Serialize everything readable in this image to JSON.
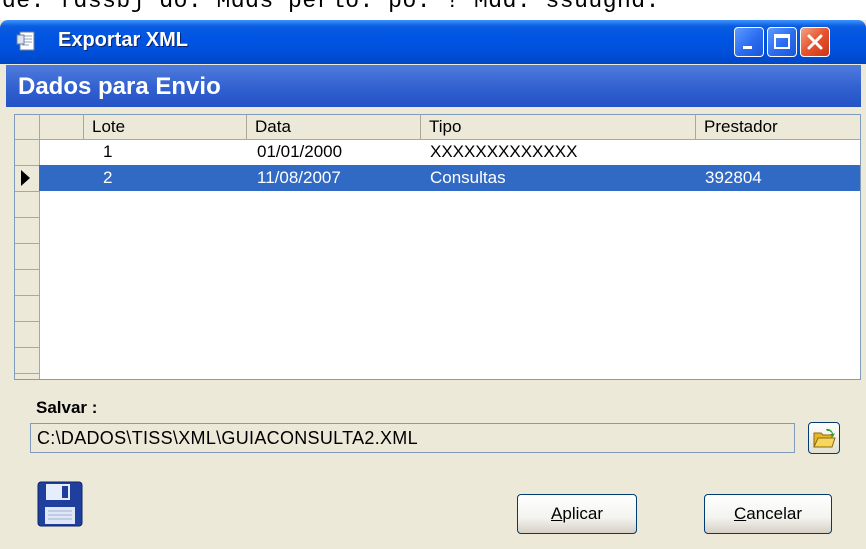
{
  "top_strip_text": "de: fdssbj do: Mdds perlo: po: ! Mdd: ssuugnd:",
  "window": {
    "title": "Exportar XML",
    "section_title": "Dados para Envio"
  },
  "grid": {
    "columns": [
      "Lote",
      "Data",
      "Tipo",
      "Prestador"
    ],
    "rows": [
      {
        "lote": "1",
        "data": "01/01/2000",
        "tipo": "XXXXXXXXXXXXX",
        "prestador": ""
      },
      {
        "lote": "2",
        "data": "11/08/2007",
        "tipo": "Consultas",
        "prestador": "392804"
      }
    ],
    "selected_row": 2
  },
  "save": {
    "label": "Salvar :",
    "path": "C:\\DADOS\\TISS\\XML\\GUIACONSULTA2.XML"
  },
  "buttons": {
    "apply": {
      "accel": "A",
      "rest": "plicar"
    },
    "cancel": {
      "accel": "C",
      "rest": "ancelar"
    }
  },
  "icons": [
    "document-icon",
    "minimize-icon",
    "maximize-icon",
    "close-icon",
    "folder-open-icon",
    "floppy-disk-icon",
    "row-pointer-icon"
  ],
  "colors": {
    "titlebar": "#0054e3",
    "selection": "#316ac5",
    "face": "#ece9d8"
  }
}
